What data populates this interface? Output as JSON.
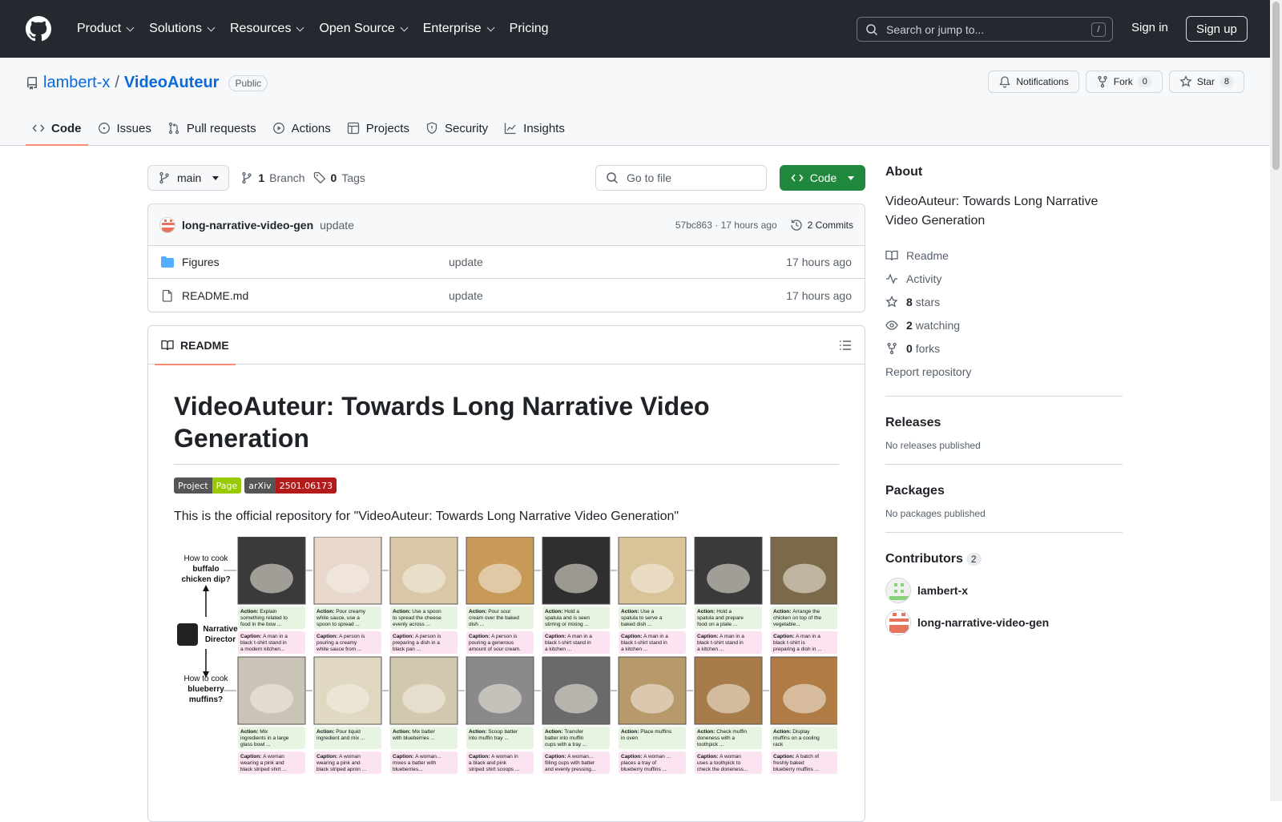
{
  "topbar": {
    "nav": [
      "Product",
      "Solutions",
      "Resources",
      "Open Source",
      "Enterprise",
      "Pricing"
    ],
    "search_placeholder": "Search or jump to...",
    "search_key": "/",
    "signin": "Sign in",
    "signup": "Sign up"
  },
  "repo": {
    "owner": "lambert-x",
    "sep": "/",
    "name": "VideoAuteur",
    "visibility": "Public",
    "notifications": "Notifications",
    "fork_label": "Fork",
    "fork_count": "0",
    "star_label": "Star",
    "star_count": "8"
  },
  "tabs": [
    "Code",
    "Issues",
    "Pull requests",
    "Actions",
    "Projects",
    "Security",
    "Insights"
  ],
  "toolbar": {
    "branch": "main",
    "branches_count": "1",
    "branches_label": "Branch",
    "tags_count": "0",
    "tags_label": "Tags",
    "gofile_placeholder": "Go to file",
    "code_label": "Code"
  },
  "commit": {
    "author": "long-narrative-video-gen",
    "message": "update",
    "hash": "57bc863",
    "dot": "·",
    "time": "17 hours ago",
    "commits": "2 Commits"
  },
  "files": [
    {
      "name": "Figures",
      "type": "folder",
      "message": "update",
      "time": "17 hours ago"
    },
    {
      "name": "README.md",
      "type": "file",
      "message": "update",
      "time": "17 hours ago"
    }
  ],
  "readme": {
    "tab": "README",
    "title": "VideoAuteur: Towards Long Narrative Video Generation",
    "shields": [
      {
        "left": "Project",
        "right": "Page",
        "color": "#97ca00"
      },
      {
        "left": "arXiv",
        "right": "2501.06173",
        "color": "#b31b1b"
      }
    ],
    "intro": "This is the official repository for \"VideoAuteur: Towards Long Narrative Video Generation\"",
    "figure": {
      "q1": [
        "How to cook",
        "buffalo",
        "chicken dip?"
      ],
      "director": [
        "Narrative",
        "Director"
      ],
      "q2": [
        "How to cook",
        "blueberry",
        "muffins?"
      ],
      "actions1": [
        [
          "Action:",
          "Explain",
          "something related to",
          "food in the bow ..."
        ],
        [
          "Action:",
          "Pour creamy",
          "white sauce, use a",
          "spoon to spread ..."
        ],
        [
          "Action:",
          "Use a spoon",
          "to spread the cheese",
          "evenly across ..."
        ],
        [
          "Action:",
          "Pour sour",
          "cream over the baked",
          "dish ..."
        ],
        [
          "Action:",
          "Hold a",
          "spatula and is seen",
          "stirring or mixing ..."
        ],
        [
          "Action:",
          "Use a",
          "spatula to serve a",
          "baked dish ..."
        ],
        [
          "Action:",
          "Hold a",
          "spatula and prepare",
          "food on a plate ..."
        ],
        [
          "Action:",
          "Arrange the",
          "chicken on top of the",
          "vegetable..."
        ]
      ],
      "captions1": [
        [
          "Caption:",
          "A man in a",
          "black t-shirt stand in",
          "a modern kitchen..."
        ],
        [
          "Caption:",
          "A person is",
          "pouring a creamy",
          "white sauce from ..."
        ],
        [
          "Caption:",
          "A person is",
          "preparing a dish in a",
          "black pan ..."
        ],
        [
          "Caption:",
          "A person is",
          "pouring a generous",
          "amount of sour cream."
        ],
        [
          "Caption:",
          "A man in a",
          "black t-shirt stand in",
          "a kitchen ..."
        ],
        [
          "Caption:",
          "A man in a",
          "black t-shirt stand in",
          "a kitchen ..."
        ],
        [
          "Caption:",
          "A man in a",
          "black t-shirt stand in",
          "a kitchen ..."
        ],
        [
          "Caption:",
          "A man in a",
          "black t-shirt is",
          "preparing a dish in ..."
        ]
      ],
      "actions2": [
        [
          "Action:",
          "Mix",
          "ingredients in a large",
          "glass bowl ..."
        ],
        [
          "Action:",
          "Pour liquid",
          "ingredient and mix ...",
          ""
        ],
        [
          "Action:",
          "Mix batter",
          "with blueberries ...",
          ""
        ],
        [
          "Action:",
          "Scoop batter",
          "into muffin tray ...",
          ""
        ],
        [
          "Action:",
          "Transfer",
          "batter into muffin",
          "cups with a tray ..."
        ],
        [
          "Action:",
          "Place muffins",
          "in oven",
          ""
        ],
        [
          "Action:",
          "Check muffin",
          "doneness with a",
          "toothpick ..."
        ],
        [
          "Action:",
          "Display",
          "muffins on a cooling",
          "rack"
        ]
      ],
      "captions2": [
        [
          "Caption:",
          "A woman",
          "wearing a pink and",
          "black striped shirt ..."
        ],
        [
          "Caption:",
          "A woman",
          "wearing a pink and",
          "black striped apron ..."
        ],
        [
          "Caption:",
          "A woman...",
          "mixes a batter with",
          "blueberries..."
        ],
        [
          "Caption:",
          "A woman in",
          "a black and pink",
          "striped shirt scoops ..."
        ],
        [
          "Caption:",
          "A woman...",
          "filling cups with batter",
          "and evenly pressing..."
        ],
        [
          "Caption:",
          "A woman ...",
          "places a tray of",
          "blueberry muffins ..."
        ],
        [
          "Caption:",
          "A woman",
          "uses a toothpick to",
          "check the doneness..."
        ],
        [
          "Caption:",
          "A batch of",
          "freshly baked",
          "blueberry muffins ..."
        ]
      ]
    }
  },
  "about": {
    "title": "About",
    "description": "VideoAuteur: Towards Long Narrative Video Generation",
    "readme": "Readme",
    "activity": "Activity",
    "stars_count": "8",
    "stars_label": "stars",
    "watching_count": "2",
    "watching_label": "watching",
    "forks_count": "0",
    "forks_label": "forks",
    "report": "Report repository"
  },
  "releases": {
    "title": "Releases",
    "empty": "No releases published"
  },
  "packages": {
    "title": "Packages",
    "empty": "No packages published"
  },
  "contributors": {
    "title": "Contributors",
    "count": "2",
    "list": [
      "lambert-x",
      "long-narrative-video-gen"
    ]
  },
  "colors": {
    "topbar": "#24292f",
    "accent": "#0969da",
    "green": "#1f883d",
    "tab_underline": "#fd8c73"
  }
}
